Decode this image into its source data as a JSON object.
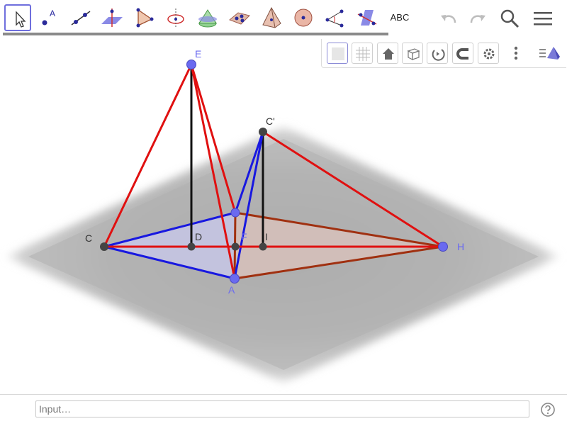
{
  "toolbar": {
    "tools": [
      {
        "id": "move",
        "icon": "cursor-arrow-icon",
        "selected": true
      },
      {
        "id": "point",
        "icon": "point-icon",
        "label": "A"
      },
      {
        "id": "line",
        "icon": "line-icon"
      },
      {
        "id": "perpendicular-line",
        "icon": "perpendicular-plane-icon"
      },
      {
        "id": "polygon",
        "icon": "triangle-icon"
      },
      {
        "id": "circle",
        "icon": "circle-axis-icon"
      },
      {
        "id": "intersect",
        "icon": "cone-icon"
      },
      {
        "id": "plane",
        "icon": "plane-points-icon"
      },
      {
        "id": "pyramid",
        "icon": "pyramid-icon"
      },
      {
        "id": "sphere",
        "icon": "sphere-icon"
      },
      {
        "id": "angle",
        "icon": "angle-icon"
      },
      {
        "id": "reflect",
        "icon": "reflect-plane-icon"
      },
      {
        "id": "text",
        "icon": "text-icon",
        "label": "ABC"
      }
    ],
    "undo_icon": "undo-icon",
    "redo_icon": "redo-icon",
    "search_icon": "search-icon",
    "menu_icon": "hamburger-menu-icon"
  },
  "style_bar": {
    "buttons": [
      "plane-toggle-icon",
      "grid-icon",
      "home-icon",
      "cube-view-icon",
      "rotate-view-icon",
      "magnet-icon",
      "gear-icon"
    ],
    "more_icon": "vertical-dots-icon",
    "view_icon": "view-pyramid-icon"
  },
  "graphics": {
    "points": {
      "E": {
        "label": "E",
        "color": "#6a6af0"
      },
      "C_prime": {
        "label": "C'",
        "color": "#333333"
      },
      "C": {
        "label": "C",
        "color": "#333333"
      },
      "D": {
        "label": "D",
        "color": "#333333"
      },
      "F": {
        "label": "F",
        "color": "#6a6af0"
      },
      "I": {
        "label": "I",
        "color": "#333333"
      },
      "H": {
        "label": "H",
        "color": "#6a6af0"
      },
      "A": {
        "label": "A",
        "color": "#6a6af0"
      }
    },
    "colors": {
      "red": "#e01010",
      "blue": "#1818e0",
      "brown": "#a03010",
      "black": "#111111",
      "point_blue": "#6a6af0",
      "point_dark": "#444444"
    }
  },
  "input_bar": {
    "placeholder": "Input…",
    "help_icon": "help-question-icon"
  }
}
